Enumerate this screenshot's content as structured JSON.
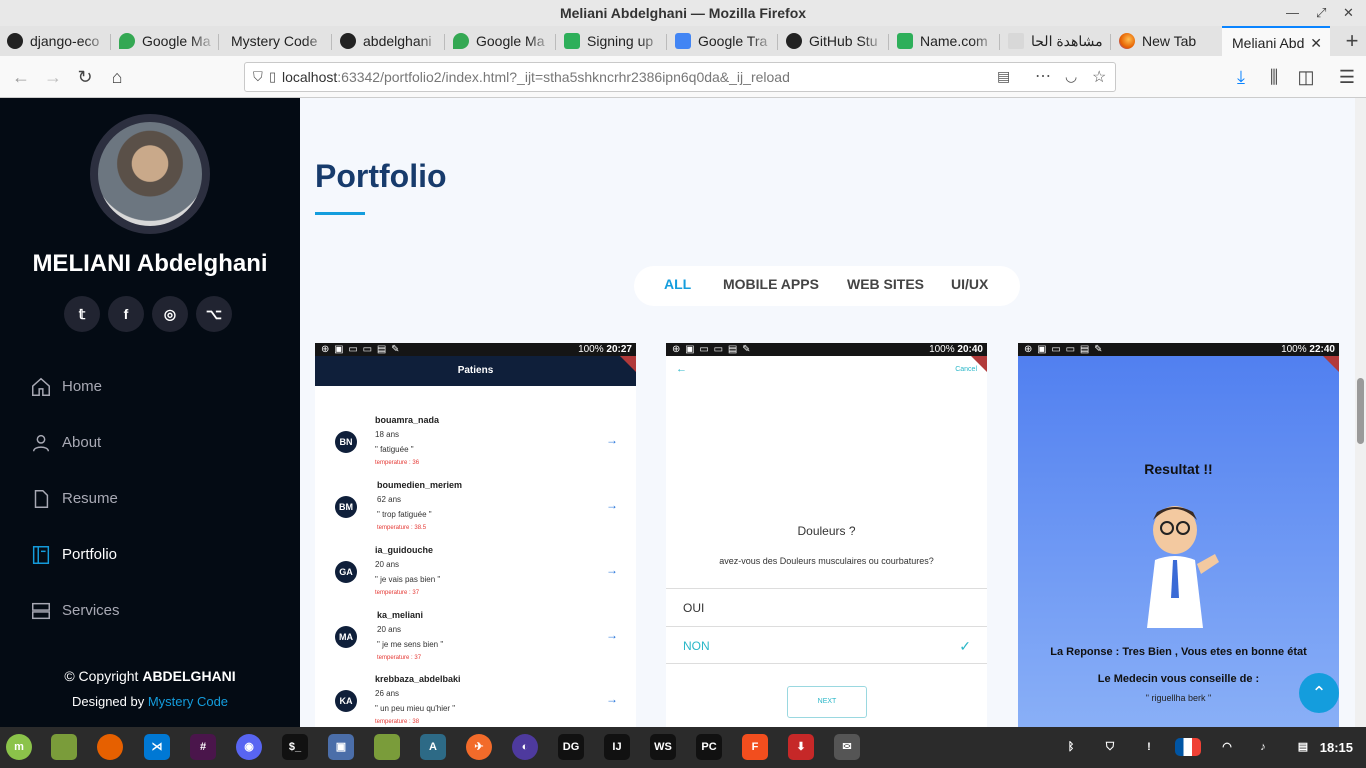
{
  "window": {
    "title": "Meliani Abdelghani — Mozilla Firefox"
  },
  "tabs": [
    {
      "label": "django-eco",
      "icon": "github-icon"
    },
    {
      "label": "Google Ma",
      "icon": "maps-icon"
    },
    {
      "label": "Mystery Code",
      "icon": ""
    },
    {
      "label": "abdelghani",
      "icon": "github-icon"
    },
    {
      "label": "Google Ma",
      "icon": "maps-icon"
    },
    {
      "label": "Signing up",
      "icon": "namecom-icon"
    },
    {
      "label": "Google Tra",
      "icon": "translate-icon"
    },
    {
      "label": "GitHub Stu",
      "icon": "github-icon"
    },
    {
      "label": "Name.com",
      "icon": "namecom-icon"
    },
    {
      "label": "مشاهدة الحا",
      "icon": "site-icon"
    },
    {
      "label": "New Tab",
      "icon": "firefox-icon"
    },
    {
      "label": "Meliani Abd",
      "icon": ""
    }
  ],
  "url": {
    "host": "localhost",
    "rest": ":63342/portfolio2/index.html?_ijt=stha5shkncrhr2386ipn6q0da&_ij_reload"
  },
  "sidebar": {
    "name": "MELIANI Abdelghani",
    "nav": [
      {
        "label": "Home",
        "icon": "home-icon"
      },
      {
        "label": "About",
        "icon": "user-icon"
      },
      {
        "label": "Resume",
        "icon": "file-icon"
      },
      {
        "label": "Portfolio",
        "icon": "book-icon"
      },
      {
        "label": "Services",
        "icon": "server-icon"
      }
    ],
    "footer_copyright": "© Copyright ",
    "footer_owner": "ABDELGHANI",
    "footer_designed": "Designed by ",
    "footer_designer": "Mystery Code"
  },
  "main": {
    "title": "Portfolio",
    "filters": [
      "ALL",
      "MOBILE APPS",
      "WEB SITES",
      "UI/UX"
    ]
  },
  "card1": {
    "time": "20:27",
    "battery": "100%",
    "appbar": "Patiens",
    "patients": [
      {
        "initials": "BN",
        "name": "bouamra_nada",
        "age": "18 ans",
        "note": "\" fatiguée \"",
        "temp": "temperature : 36"
      },
      {
        "initials": "BM",
        "name": "boumedien_meriem",
        "age": "62 ans",
        "note": "\" trop fatiguée  \"",
        "temp": "temperature : 38.5"
      },
      {
        "initials": "GA",
        "name": "ia_guidouche",
        "age": "20 ans",
        "note": "\" je vais pas bien \"",
        "temp": "temperature : 37"
      },
      {
        "initials": "MA",
        "name": "ka_meliani",
        "age": "20 ans",
        "note": "\" je me sens bien  \"",
        "temp": "temperature : 37"
      },
      {
        "initials": "KA",
        "name": "krebbaza_abdelbaki",
        "age": "26 ans",
        "note": "\" un peu mieu qu'hier  \"",
        "temp": "temperature : 38"
      }
    ]
  },
  "card2": {
    "time": "20:40",
    "battery": "100%",
    "cancel": "Cancel",
    "question": "Douleurs ?",
    "subtitle": "avez-vous des Douleurs musculaires ou courbatures?",
    "option_yes": "OUI",
    "option_no": "NON",
    "next": "NEXT"
  },
  "card3": {
    "time": "22:40",
    "battery": "100%",
    "title": "Resultat !!",
    "response": "La Reponse : Tres Bien , Vous etes en bonne état",
    "advice": "Le Medecin vous conseille de  :",
    "quote": "\" riguellha berk  \""
  },
  "taskbar": {
    "time": "18:15"
  },
  "colors": {
    "accent": "#149ddd",
    "sidebar_bg": "#040b14",
    "title_blue": "#173b6c"
  }
}
